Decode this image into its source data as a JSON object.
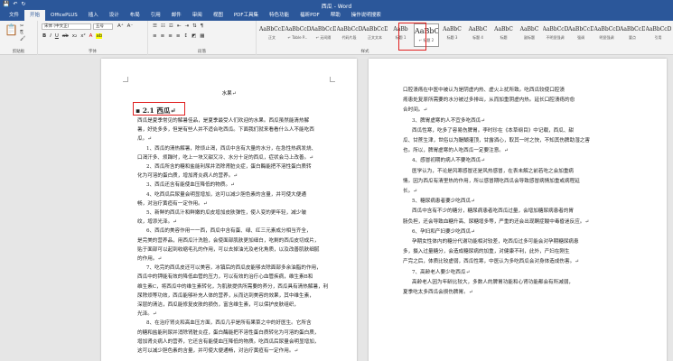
{
  "window": {
    "title": "西瓜 - Word",
    "qat": [
      "💾",
      "↶",
      "↻"
    ]
  },
  "tabs": [
    "文件",
    "开始",
    "OfficePLUS",
    "插入",
    "设计",
    "布局",
    "引用",
    "邮件",
    "审阅",
    "视图",
    "PDF工具集",
    "特色功能",
    "福昕PDF",
    "帮助",
    "操作说明搜索"
  ],
  "ribbon": {
    "font_name": "宋体 (中文正)",
    "font_size": "五号",
    "groups": [
      "剪贴板",
      "字体",
      "段落",
      "样式"
    ],
    "styles": [
      {
        "preview": "AaBbCcDd",
        "name": "正文"
      },
      {
        "preview": "AaBbCcDd",
        "name": "↵ Table P..."
      },
      {
        "preview": "AaBbCcDd",
        "name": "↵ 无间隔"
      },
      {
        "preview": "AaBbCcDd",
        "name": "代码片段"
      },
      {
        "preview": "AaBbCcDd",
        "name": "正文文本"
      },
      {
        "preview": "AaBb",
        "name": "标题 1"
      },
      {
        "preview": "AaBbC",
        "name": "↵ 标题 2"
      },
      {
        "preview": "AaBbC",
        "name": "标题 3"
      },
      {
        "preview": "AaBbC",
        "name": "标题 4"
      },
      {
        "preview": "AaBbC",
        "name": "标题"
      },
      {
        "preview": "AaBbC",
        "name": "副标题"
      },
      {
        "preview": "AaBbCcDd",
        "name": "不明显强调"
      },
      {
        "preview": "AaBbCcDd",
        "name": "强调"
      },
      {
        "preview": "AaBbCcDd",
        "name": "明显强调"
      },
      {
        "preview": "AaBbCcDd",
        "name": "要点"
      },
      {
        "preview": "AaBbCcDd",
        "name": "引用"
      }
    ]
  },
  "left_page": {
    "header": "水果↵",
    "heading": "2.1 西瓜↵",
    "lines": [
      "西瓜是夏季常见的解暑佳品，是夏季最受人们欢迎的水果。西瓜虽然能清热解",
      "暑，好处多多，但是有些人并不适合吃西瓜。下面我们就来看看什么人不能吃西",
      "瓜。↵",
      "1、西瓜的清热解暑，除烦止渴，西瓜中含有大量的水分，在急性热病发烧、",
      "口渴汗多、烦躁时，吃上一块又甜又冷、水分十足的西瓜，症状会马上改善。↵",
      "2、西瓜所含的糖和盐能利尿并消除肾脏炎症，蛋白酶能把不溶性蛋白质转",
      "化为可溶的蛋白质，增加肾炎病人的营养。↵",
      "3、西瓜还含有能使血压降低的物质。↵",
      "4、吃西瓜后尿量会明显增加，这可以减少胆色素的含量，并可使大便通",
      "畅，对治疗黄疸有一定作用。↵",
      "5、新鲜的西瓜汁和鲜嫩的瓜皮增加皮肤弹性，使人变的更年轻，减少皱",
      "纹，增添光泽。↵",
      "6、西瓜的美容作用一一西，西瓜中含有蛋、绿、红三元素成分相当齐全，",
      "是完美的营养品，用西瓜汁洗脸，会使面部肌肤更加细白，吃剩的西瓜皮切成片，",
      "贴于面部可以起到收缩毛孔的作用，可以去掉油光及老化角质，以及改善肌肤细腻",
      "的作用。↵",
      "7、吃完的西瓜皮还可以美容，冰镇后的西瓜皮能够去除面部多余油脂的作用，",
      "西瓜中的钾能有效的降低血管的压力，可以有效的治疗心血管疾病，维生素B和",
      "维生素C，将西瓜中的维生素转化，为肌肤提供所需要的养分，西瓜具有清热解暑，利",
      "尿除烦等功效，西瓜能够补充人体的营养，从而达到美容的效果，其中维生素，",
      "深层的清洁，西瓜能修复皮肤的损伤，富含维生素，可以保护皮肤组织，",
      "光泽。↵",
      "8、在治疗肾炎和高血压方面，西瓜几乎是所有果菜之中的好医生。它所含",
      "的糖和盐能利尿并消除肾脏炎症，蛋白酶能把不溶性蛋白质转化为可溶的蛋白质，",
      "增加肾炎病人的营养，它还含有能使血压降低的物质。吃西瓜后尿量会明显增加，",
      "这可以减少胆色素的含量，并可使大便通畅，对治疗黄疸有一定作用。↵"
    ]
  },
  "right_page": {
    "lines": [
      "口腔溃疡在中医中被认为是阴虚内热、虚火上扰所致。吃西瓜较使口腔溃",
      "疡患处复原所需要的水分被过多排出，从而加重阴虚内热。延长口腔溃疡的愈",
      "合时间。↵",
      "3、脾胃虚寒的人不宜多吃西瓜↵",
      "西瓜性寒，吃多了容易伤脾胃。李时珍在《本草纲目》中记载，西瓜、甜",
      "瓜、甘蔗生津，世俗以为醍醐灌顶，甘露洒心，取其一时之快，不知其伤脾助湿之害",
      "也。所以，脾胃虚寒的人吃西瓜一定要注意。↵",
      "4、感冒初期的病人不要吃西瓜↵",
      "医学认为，不论是风寒感冒还是风热感冒，在表未解之前若吃之会加重病",
      "情。因为西瓜有清里热的作用，所以感冒期吃西瓜会导致感冒病情加重或病程延",
      "长。↵",
      "5、糖尿病患者要少吃西瓜↵",
      "西瓜中含有不少的糖分，糖尿病患者吃西瓜过量，会增加糖尿病患者的胃",
      "肠负担，还会导致血糖升高、尿糖增多等，严重的还会出现酮症酸中毒昏迷反应。↵",
      "6、孕妇和产妇要少吃西瓜↵",
      "孕期女性体内的糖分代谢功能相对较差，吃西瓜过多可能会对孕期糖尿病患",
      "多，摄入过量糖分，会造成糖尿病的加重，对健康不利，此外，产妇在刚生",
      "产完之后，体质比较虚弱，西瓜性寒，中医认为多吃西瓜会对身体造成伤害。↵",
      "7、高龄老人要少吃西瓜↵",
      "高龄老人因为年龄比较大，多数人的脾胃功能和心肾功能都会有所减弱，",
      "夏季吃太多西瓜会损伤脾胃。↵"
    ]
  }
}
